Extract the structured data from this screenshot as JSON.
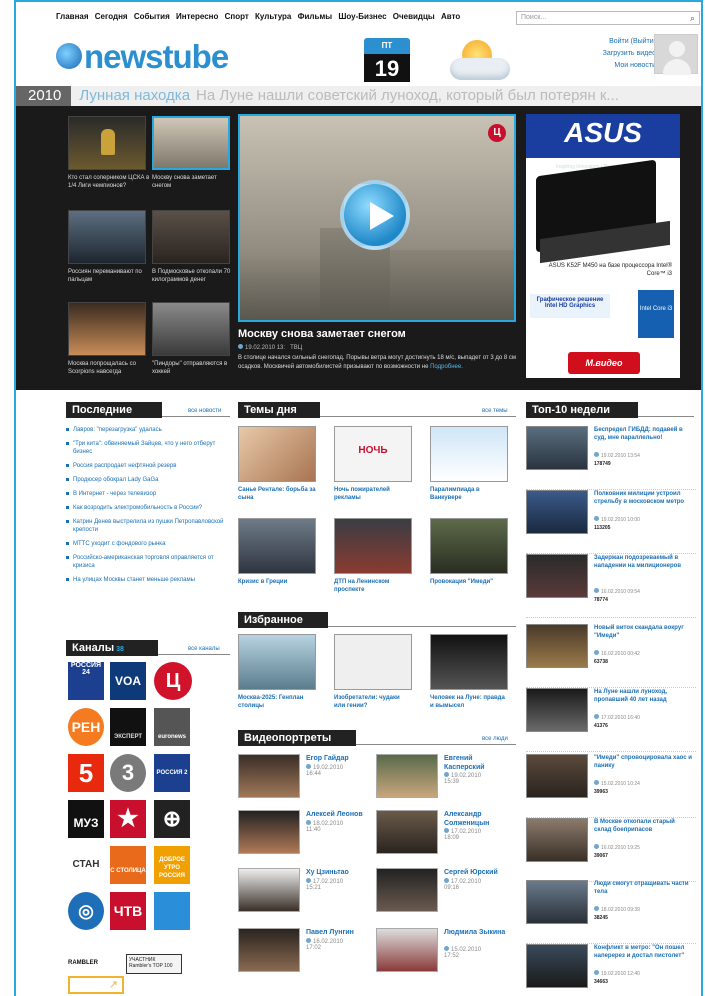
{
  "nav": [
    "Главная",
    "Сегодня",
    "События",
    "Интересно",
    "Спорт",
    "Культура",
    "Фильмы",
    "Шоу-Бизнес",
    "Очевидцы",
    "Авто"
  ],
  "search": {
    "placeholder": "Поиск..."
  },
  "logo": "newstube",
  "calendar": {
    "weekday": "ПТ",
    "day": "19"
  },
  "user": {
    "login": "Войти (Выйти)",
    "upload": "Загрузить видео",
    "my_news": "Мои новости"
  },
  "ticker": {
    "year": "2010",
    "headline": "Лунная находка",
    "text": "На Луне нашли советский луноход, который был потерян к..."
  },
  "featured_thumbs": [
    {
      "caption": "Кто стал соперником ЦСКА в 1/4 Лиги чемпионов?"
    },
    {
      "caption": "Москву снова заметает снегом"
    },
    {
      "caption": "Россиян переманивают по пальцам"
    },
    {
      "caption": "В Подмосковье откопали 70 килограммов денег"
    },
    {
      "caption": "Москва попрощалась со Scorpions навсегда"
    },
    {
      "caption": "\"Пиндоры\" отправляются в хоккей"
    }
  ],
  "main_video": {
    "title": "Москву снова заметает снегом",
    "date": "19.02.2010 13:",
    "meta": "ТВЦ",
    "description": "В столице начался сильный снегопад. Порывы ветра могут достигнуть 18 м/с, выпадет от 3 до 8 см осадков. Москвичей автомобилистей призывают по возможности не",
    "more": "Подробнее."
  },
  "ad": {
    "brand": "ASUS",
    "tagline": "Inspiring Innovation • Persistent Perfection",
    "model": "ASUS K52F M450 на базе процессора Intel® Core™ i3",
    "graphics": "Графическое решение Intel HD Graphics",
    "core": "Intel Core i3",
    "retailer": "М.видео"
  },
  "latest": {
    "title": "Последние",
    "all_link": "все новости",
    "items": [
      "Лавров: \"перезагрузка\" удалась",
      "\"Три кита\": обвиняемый Зайцев, что у него отберут бизнес",
      "Россия распродает нефтяной резерв",
      "Продюсер обокрал Lady GaGa",
      "В Интернет - через телевизор",
      "Как возродить электромобильность в России?",
      "Катрин Денев выстрелила из пушки Петропавловской крепости",
      "МТТС уходит с фондового рынка",
      "Российско-американская торговля оправляется от кризиса",
      "На улицах Москвы станет меньше рекламы"
    ]
  },
  "channels": {
    "title": "Каналы",
    "count": "38",
    "all_link": "все каналы",
    "logos": [
      "РОССИЯ 24",
      "VOA",
      "Ц",
      "РЕН",
      "ЭКСПЕРТ",
      "euronews",
      "5",
      "3",
      "РОССИЯ 2",
      "МУЗ",
      "★",
      "⊕",
      "СТАН",
      "С СТОЛИЦА",
      "ДОБРОЕ УТРО РОССИЯ",
      "◎",
      "ЧТВ",
      ""
    ]
  },
  "themes": {
    "title": "Темы дня",
    "all_link": "все темы",
    "items": [
      "Санье Рентале: борьба за сына",
      "Ночь пожирателей рекламы",
      "Паралимпиада в Ванкувере",
      "Кризис в Греции",
      "ДТП на Ленинском проспекте",
      "Провокация \"Имеди\""
    ]
  },
  "favorites": {
    "title": "Избранное",
    "items": [
      "Москва-2025: Генплан столицы",
      "Изобретатели: чудаки или гении?",
      "Человек на Луне: правда и вымысел"
    ]
  },
  "portraits": {
    "title": "Видеопортреты",
    "all_link": "все люди",
    "items": [
      {
        "name": "Егор Гайдар",
        "date": "19.02.2010",
        "time": "16:44"
      },
      {
        "name": "Евгений Касперский",
        "date": "19.02.2010",
        "time": "15:39"
      },
      {
        "name": "Алексей Леонов",
        "date": "18.02.2010",
        "time": "11:40"
      },
      {
        "name": "Александр Солженицын",
        "date": "17.02.2010",
        "time": "18:09"
      },
      {
        "name": "Ху Цзиньтао",
        "date": "17.02.2010",
        "time": "15:21"
      },
      {
        "name": "Сергей Юрский",
        "date": "17.02.2010",
        "time": "09:16"
      },
      {
        "name": "Павел Лунгин",
        "date": "16.02.2010",
        "time": "17:02"
      },
      {
        "name": "Людмила Зыкина",
        "date": "15.02.2010",
        "time": "17:52"
      }
    ]
  },
  "top10": {
    "title": "Топ-10 недели",
    "items": [
      {
        "title": "Беспредел ГИБДД: подавей в суд, мне параллельно!",
        "date": "19.02.2010 13:54",
        "views": "178749"
      },
      {
        "title": "Полковник милиции устроил стрельбу в московском метро",
        "date": "19.02.2010 10:00",
        "views": "113205"
      },
      {
        "title": "Задержан подозреваемый в нападении на милиционеров",
        "date": "16.02.2010 09:54",
        "views": "78774"
      },
      {
        "title": "Новый виток скандала вокруг \"Имеди\"",
        "date": "16.02.2010 00:42",
        "views": "63738"
      },
      {
        "title": "На Луне нашли луноход, пропавший 40 лет назад",
        "date": "17.02.2010 16:40",
        "views": "41376"
      },
      {
        "title": "\"Имеди\" спровоцировала хаос и панику",
        "date": "15.02.2010 10:24",
        "views": "39963"
      },
      {
        "title": "В Москве откопали старый склад боеприпасов",
        "date": "16.02.2010 19:25",
        "views": "39067"
      },
      {
        "title": "Люди смогут отращивать части тела",
        "date": "18.02.2010 09:39",
        "views": "38245"
      },
      {
        "title": "Конфликт в метро: \"Он пошел наперерез и достал пистолет\"",
        "date": "19.02.2010 12:40",
        "views": "34663"
      }
    ]
  },
  "footer": {
    "counter": "RAMBLER",
    "badge": "УЧАСТНИК Rambler's TOP 100"
  }
}
